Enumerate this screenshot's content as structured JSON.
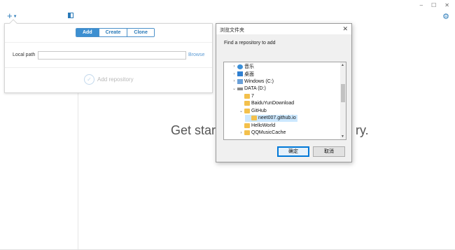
{
  "topbar": {
    "add_icon": "plus-icon",
    "caret_icon": "caret-down-icon",
    "sidebar_icon": "sidebar-toggle-icon",
    "settings_icon": "gear-icon"
  },
  "window_controls": {
    "minimize": "–",
    "maximize": "☐",
    "close": "✕"
  },
  "popover": {
    "tabs": [
      {
        "label": "Add",
        "active": true
      },
      {
        "label": "Create",
        "active": false
      },
      {
        "label": "Clone",
        "active": false
      }
    ],
    "local_path_label": "Local path",
    "local_path_value": "",
    "browse_label": "Browse",
    "add_repo_label": "Add repository",
    "add_repo_icon": "check-circle-icon"
  },
  "hero": {
    "left": "Get star",
    "right": "ry."
  },
  "dialog": {
    "title": "浏览文件夹",
    "close": "✕",
    "prompt": "Find a repository to add",
    "tree": [
      {
        "label": "音乐",
        "expander": "›",
        "icon": "music",
        "depth": 0
      },
      {
        "label": "桌面",
        "expander": "›",
        "icon": "desktop",
        "depth": 0
      },
      {
        "label": "Windows (C:)",
        "expander": "›",
        "icon": "drivec",
        "depth": 0
      },
      {
        "label": "DATA (D:)",
        "expander": "⌄",
        "icon": "drived",
        "depth": 0
      },
      {
        "label": "7",
        "expander": "",
        "icon": "folder",
        "depth": 1
      },
      {
        "label": "BaiduYunDownload",
        "expander": "",
        "icon": "folder",
        "depth": 1
      },
      {
        "label": "GitHub",
        "expander": "⌄",
        "icon": "folder",
        "depth": 1
      },
      {
        "label": "neet007.github.io",
        "expander": "",
        "icon": "folder",
        "depth": 2,
        "selected": true
      },
      {
        "label": "HelloWorld",
        "expander": "",
        "icon": "folder",
        "depth": 1
      },
      {
        "label": "QQMusicCache",
        "expander": "›",
        "icon": "folder",
        "depth": 1
      }
    ],
    "ok_label": "确定",
    "cancel_label": "取消"
  },
  "colors": {
    "accent": "#3d8fd1",
    "link": "#5b9bd5",
    "selection": "#cce8ff"
  }
}
